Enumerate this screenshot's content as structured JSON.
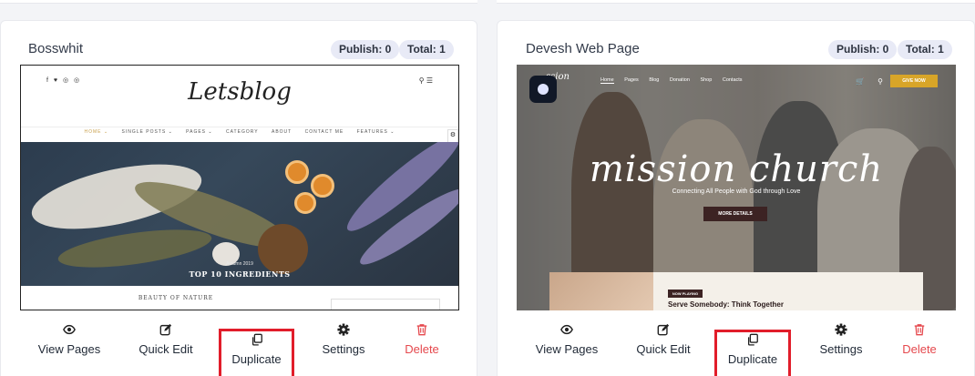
{
  "colors": {
    "accent": "#e11d2a",
    "delete": "#e5484d",
    "pill_bg": "#e8eaf6",
    "text": "#222b38"
  },
  "cards": [
    {
      "title": "Bosswhit",
      "publish_label": "Publish: 0",
      "total_label": "Total: 1",
      "thumbnail": {
        "social": "f ♥ ◎ ◎",
        "logo": "Letsblog",
        "tools": "⚲ ☰",
        "nav": [
          "HOME ⌄",
          "SINGLE POSTS ⌄",
          "PAGES ⌄",
          "CATEGORY",
          "ABOUT",
          "CONTACT ME",
          "FEATURES ⌄"
        ],
        "post_kicker": "Autumn 2019",
        "post_title": "TOP 10 INGREDIENTS",
        "sub_heading": "BEAUTY OF NATURE"
      },
      "actions": [
        {
          "label": "View Pages",
          "icon": "eye-icon"
        },
        {
          "label": "Quick Edit",
          "icon": "edit-icon"
        },
        {
          "label": "Duplicate",
          "icon": "copy-icon"
        },
        {
          "label": "Settings",
          "icon": "gear-icon"
        },
        {
          "label": "Delete",
          "icon": "trash-icon"
        }
      ]
    },
    {
      "title": "Devesh Web Page",
      "publish_label": "Publish: 0",
      "total_label": "Total: 1",
      "thumbnail": {
        "brand": "ssion",
        "nav": [
          "Home",
          "Pages",
          "Blog",
          "Donation",
          "Shop",
          "Contacts"
        ],
        "icons": "🛒 ⚲",
        "cta": "GIVE NOW",
        "headline": "mission church",
        "tagline": "Connecting All People with God through Love",
        "more": "MORE DETAILS",
        "badge": "NOW PLAYING",
        "serve_title": "Serve Somebody: Think Together"
      },
      "actions": [
        {
          "label": "View Pages",
          "icon": "eye-icon"
        },
        {
          "label": "Quick Edit",
          "icon": "edit-icon"
        },
        {
          "label": "Duplicate",
          "icon": "copy-icon"
        },
        {
          "label": "Settings",
          "icon": "gear-icon"
        },
        {
          "label": "Delete",
          "icon": "trash-icon"
        }
      ]
    }
  ]
}
